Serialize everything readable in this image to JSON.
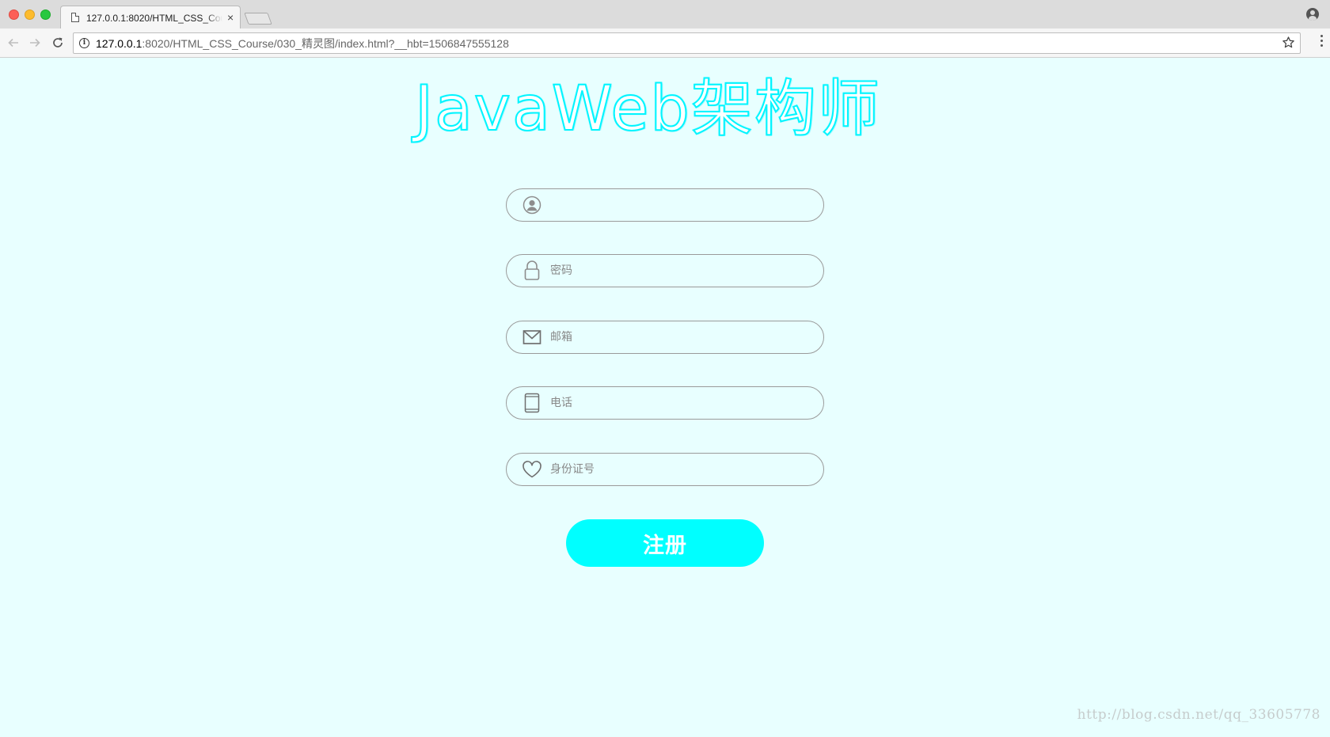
{
  "browser": {
    "tab_title": "127.0.0.1:8020/HTML_CSS_Course/030_精灵图/index.html?__hbt=1506847555128",
    "tab_close": "×",
    "url_host": "127.0.0.1",
    "url_rest": ":8020/HTML_CSS_Course/030_精灵图/index.html?__hbt=1506847555128",
    "icons": {
      "back": "arrow-left-icon",
      "forward": "arrow-right-icon",
      "reload": "reload-icon",
      "info": "info-icon",
      "star": "star-icon",
      "menu": "menu-icon",
      "profile": "profile-icon"
    }
  },
  "page": {
    "logo": "JavaWeb架构师",
    "fields": {
      "username": {
        "placeholder": "",
        "value": "",
        "icon": "user-icon"
      },
      "password": {
        "placeholder": "密码",
        "value": "",
        "icon": "lock-icon"
      },
      "email": {
        "placeholder": "邮箱",
        "value": "",
        "icon": "mail-icon"
      },
      "phone": {
        "placeholder": "电话",
        "value": "",
        "icon": "phone-icon"
      },
      "id_card": {
        "placeholder": "身份证号",
        "value": "",
        "icon": "heart-icon"
      }
    },
    "submit_label": "注册",
    "watermark": "http://blog.csdn.net/qq_33605778"
  },
  "colors": {
    "page_background": "#e8ffff",
    "accent": "#00ffff",
    "field_border": "#9a9a9a"
  }
}
